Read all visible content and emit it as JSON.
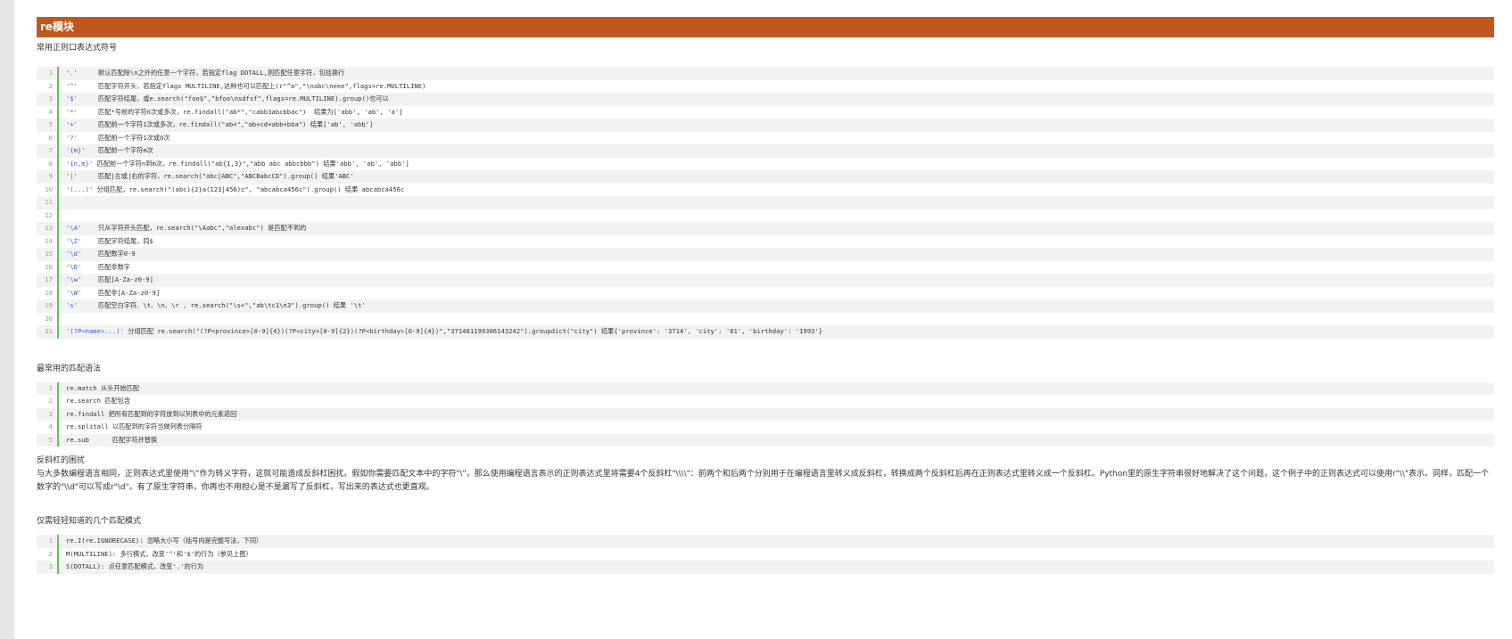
{
  "title": "re模块",
  "section1": {
    "heading": "常用正则口表达式符号",
    "lines": [
      {
        "num": "1",
        "sym": "'.'",
        "desc": "默认匹配除\\n之外的任意一个字符，若指定flag DOTALL,则匹配任意字符，包括换行"
      },
      {
        "num": "2",
        "sym": "'^'",
        "desc": "匹配字符开头，若指定flags MULTILINE,这种也可以匹配上(r\"^a\",\"\\nabc\\neee\",flags=re.MULTILINE)"
      },
      {
        "num": "3",
        "sym": "'$'",
        "desc": "匹配字符结尾，或e.search(\"foo$\",\"bfoo\\nsdfsf\",flags=re.MULTILINE).group()也可以"
      },
      {
        "num": "4",
        "sym": "'*'",
        "desc": "匹配*号前的字符0次或多次，re.findall(\"ab*\",\"cabb3abcbbac\")  结果为['abb', 'ab', 'a']"
      },
      {
        "num": "5",
        "sym": "'+'",
        "desc": "匹配前一个字符1次或多次，re.findall(\"ab+\",\"ab+cd+abb+bba\") 结果['ab', 'abb']"
      },
      {
        "num": "6",
        "sym": "'?'",
        "desc": "匹配前一个字符1次或0次"
      },
      {
        "num": "7",
        "sym": "'{m}'",
        "desc": "匹配前一个字符m次"
      },
      {
        "num": "8",
        "sym": "'{n,m}'",
        "desc": "匹配前一个字符n到m次，re.findall(\"ab{1,3}\",\"abb abc abbcbbb\") 结果'abb', 'ab', 'abb']"
      },
      {
        "num": "9",
        "sym": "'|'",
        "desc": "匹配|左或|右的字符，re.search(\"abc|ABC\",\"ABCBabcCD\").group() 结果'ABC'"
      },
      {
        "num": "10",
        "sym": "'(...)'",
        "desc": "分组匹配，re.search(\"(abc){2}a(123|456)c\", \"abcabca456c\").group() 结果 abcabca456c"
      },
      {
        "num": "11",
        "sym": "",
        "desc": ""
      },
      {
        "num": "12",
        "sym": "",
        "desc": ""
      },
      {
        "num": "13",
        "sym": "'\\A'",
        "desc": "只从字符开头匹配，re.search(\"\\Aabc\",\"alexabc\") 是匹配不到的"
      },
      {
        "num": "14",
        "sym": "'\\Z'",
        "desc": "匹配字符结尾，同$"
      },
      {
        "num": "15",
        "sym": "'\\d'",
        "desc": "匹配数字0-9"
      },
      {
        "num": "16",
        "sym": "'\\D'",
        "desc": "匹配非数字"
      },
      {
        "num": "17",
        "sym": "'\\w'",
        "desc": "匹配[A-Za-z0-9]"
      },
      {
        "num": "18",
        "sym": "'\\W'",
        "desc": "匹配非[A-Za-z0-9]"
      },
      {
        "num": "19",
        "sym": "'s'",
        "desc": "匹配空白字符、\\t、\\n、\\r , re.search(\"\\s+\",\"ab\\tc1\\n3\").group() 结果 '\\t'"
      },
      {
        "num": "20",
        "sym": "",
        "desc": ""
      },
      {
        "num": "21",
        "sym": "'(?P<name>...)'",
        "desc": "分组匹配 re.search(\"(?P<province>[0-9]{4})(?P<city>[0-9]{2})(?P<birthday>[0-9]{4})\",\"371481199306143242\").groupdict(\"city\") 结果{'province': '3714', 'city': '81', 'birthday': '1993'}"
      }
    ]
  },
  "section2": {
    "heading": "最常用的匹配语法",
    "lines": [
      {
        "num": "1",
        "text": "re.match 从头开始匹配"
      },
      {
        "num": "2",
        "text": "re.search 匹配包含"
      },
      {
        "num": "3",
        "text": "re.findall 把所有匹配到的字符放到以列表中的元素返回"
      },
      {
        "num": "4",
        "text": "re.splitall 以匹配到的字符当做列表分隔符"
      },
      {
        "num": "5",
        "text": "re.sub      匹配字符并替换"
      }
    ]
  },
  "section3": {
    "heading": "反斜杠的困扰",
    "paragraph": "与大多数编程语言相同，正则表达式里使用\"\\\"作为转义字符，这就可能造成反斜杠困扰。假如你需要匹配文本中的字符\"\\\"，那么使用编程语言表示的正则表达式里将需要4个反斜杠\"\\\\\\\\\"：前两个和后两个分别用于在编程语言里转义成反斜杠，转换成两个反斜杠后再在正则表达式里转义成一个反斜杠。Python里的原生字符串很好地解决了这个问题，这个例子中的正则表达式可以使用r\"\\\\\"表示。同样，匹配一个数字的\"\\\\d\"可以写成r\"\\d\"。有了原生字符串，你再也不用担心是不是漏写了反斜杠，写出来的表达式也更直观。"
  },
  "section4": {
    "heading": "仅需轻轻知道的几个匹配模式",
    "lines": [
      {
        "num": "1",
        "text": "re.I(re.IGNORECASE): 忽略大小写（括号内是完整写法，下同）"
      },
      {
        "num": "2",
        "text": "M(MULTILINE): 多行模式，改变'^'和'$'的行为（参见上图）"
      },
      {
        "num": "3",
        "text": "S(DOTALL): 点任意匹配模式，改变'.'的行为"
      }
    ]
  }
}
